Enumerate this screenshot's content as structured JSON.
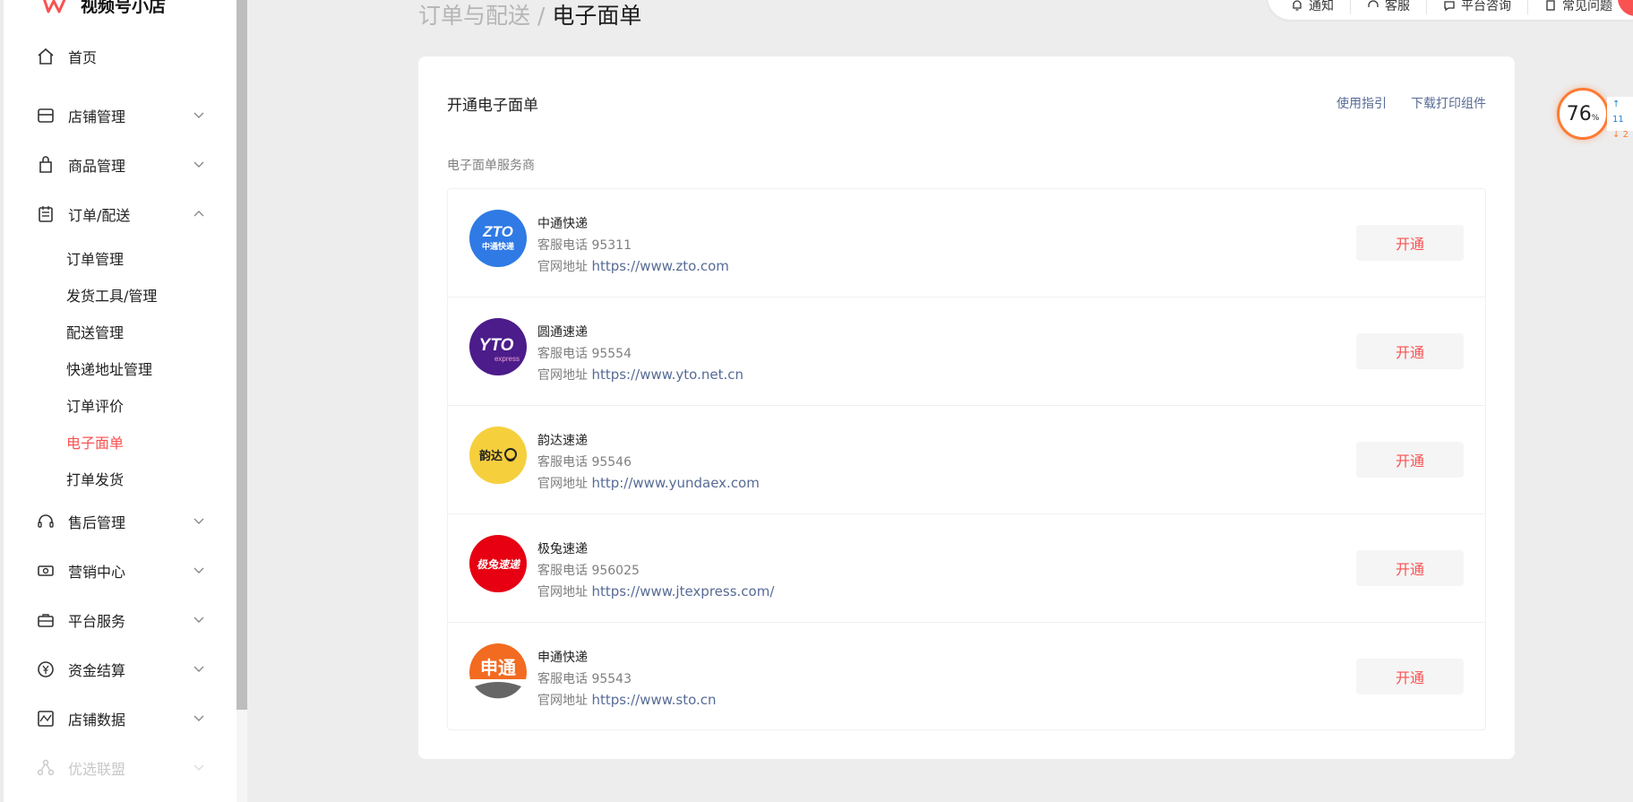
{
  "brand": {
    "name": "视频号小店"
  },
  "sidebar": {
    "items": [
      {
        "label": "首页",
        "icon": "home-icon"
      },
      {
        "label": "店铺管理",
        "icon": "store-icon"
      },
      {
        "label": "商品管理",
        "icon": "shopping-bag-icon"
      },
      {
        "label": "订单/配送",
        "icon": "clipboard-icon",
        "expanded": true,
        "children": [
          "订单管理",
          "发货工具/管理",
          "配送管理",
          "快递地址管理",
          "订单评价",
          "电子面单",
          "打单发货"
        ],
        "active_child": "电子面单"
      },
      {
        "label": "售后管理",
        "icon": "headset-icon"
      },
      {
        "label": "营销中心",
        "icon": "ticket-icon"
      },
      {
        "label": "平台服务",
        "icon": "briefcase-icon"
      },
      {
        "label": "资金结算",
        "icon": "yen-icon"
      },
      {
        "label": "店铺数据",
        "icon": "chart-icon"
      },
      {
        "label": "优选联盟",
        "icon": "network-icon",
        "disabled": true
      }
    ]
  },
  "header": {
    "breadcrumb_parent": "订单与配送",
    "breadcrumb_sep": " / ",
    "breadcrumb_current": "电子面单",
    "topbar": [
      "通知",
      "客服",
      "平台咨询",
      "常见问题"
    ]
  },
  "main": {
    "title": "开通电子面单",
    "links": [
      "使用指引",
      "下载打印组件"
    ],
    "section_label": "电子面单服务商",
    "phone_prefix": "客服电话 ",
    "site_prefix": "官网地址 ",
    "button_label": "开通",
    "providers": [
      {
        "name": "中通快递",
        "phone": "95311",
        "url": "https://www.zto.com",
        "logo_color": "#2f7ae5",
        "logo_text": "ZTO",
        "logo_sub": "中通快递"
      },
      {
        "name": "圆通速递",
        "phone": "95554",
        "url": "https://www.yto.net.cn",
        "logo_color": "#4b1c8a",
        "logo_text": "YTO",
        "logo_sub": "express"
      },
      {
        "name": "韵达速递",
        "phone": "95546",
        "url": "http://www.yundaex.com",
        "logo_color": "#f6cf3d",
        "logo_text": "韵达",
        "logo_sub": ""
      },
      {
        "name": "极兔速递",
        "phone": "956025",
        "url": "https://www.jtexpress.com/",
        "logo_color": "#e60012",
        "logo_text": "极兔速递",
        "logo_sub": ""
      },
      {
        "name": "申通快递",
        "phone": "95543",
        "url": "https://www.sto.cn",
        "logo_color": "#f26b21",
        "logo_text": "申通",
        "logo_sub": ""
      }
    ]
  },
  "widget": {
    "value": "76",
    "unit": "%",
    "up": "11",
    "down": "2"
  },
  "colors": {
    "accent": "#fa5151",
    "link": "#576b95",
    "widget_ring": "#ff7a33"
  }
}
